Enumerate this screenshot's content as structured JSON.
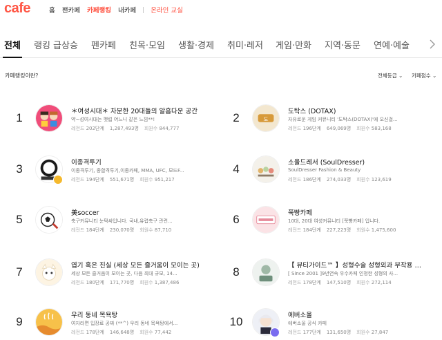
{
  "header": {
    "logo": "cafe",
    "nav": [
      "홈",
      "팬카페",
      "카페랭킹",
      "내카페"
    ],
    "active_nav": "카페랭킹",
    "extra_link": "온라인 교실"
  },
  "tabs": [
    "전체",
    "랭킹 급상승",
    "펜카페",
    "친목·모임",
    "생활·경제",
    "취미·레저",
    "게임·만화",
    "지역·동문",
    "연예·예술"
  ],
  "subbar": {
    "help": "카페랭킹이란?",
    "grade_filter": "전체등급 ⌄",
    "sort_filter": "카페점수 ⌄"
  },
  "colors": {
    "brand": "#ff5645",
    "badge_gold": "#f5b92d",
    "badge_purple": "#7a6cf0"
  },
  "rankings": [
    {
      "rank": "1",
      "name": "＊여성시대＊ 차분한 20대들의 알흠다운 공간",
      "desc": "약~성여시대는 펫럽 어느니 같은 느낌**!",
      "grade_label": "레전드",
      "grade_val": "202단계",
      "members": "1,287,493명",
      "visits_label": "회원수",
      "visits": "844,777",
      "icon": "yeosidae-thumb"
    },
    {
      "rank": "2",
      "name": "도탁스 (DOTAX)",
      "desc": "자유로운 게임 커뮤니티 '도탁스(DOTAX)'에 오신걸...",
      "grade_label": "레전드",
      "grade_val": "196단계",
      "members": "649,069명",
      "visits_label": "회원수",
      "visits": "583,168",
      "icon": "dotax-thumb"
    },
    {
      "rank": "3",
      "name": "이종격투기",
      "desc": "이종격투기, 종합격투기,이종카페, MMA, UFC, 모드F...",
      "grade_label": "레전드",
      "grade_val": "194단계",
      "members": "551,671명",
      "visits_label": "회원수",
      "visits": "951,217",
      "icon": "mma-thumb",
      "badge": "gold"
    },
    {
      "rank": "4",
      "name": "소울드레서 (SoulDresser)",
      "desc": "SoulDresser Fashion & Beauty",
      "grade_label": "레전드",
      "grade_val": "186단계",
      "members": "274,033명",
      "visits_label": "회원수",
      "visits": "123,619",
      "icon": "souldresser-thumb"
    },
    {
      "rank": "5",
      "name": "美soccer",
      "desc": "축구커뮤니티 눈팍싸입니다. 국내,유럽축구 관련...",
      "grade_label": "레전드",
      "grade_val": "184단계",
      "members": "230,070명",
      "visits_label": "회원수",
      "visits": "87,710",
      "icon": "soccer-thumb"
    },
    {
      "rank": "6",
      "name": "쭉빵카페",
      "desc": "10대, 20대 여성커뮤니티 [쭉빵카페] 입니다.",
      "grade_label": "레전드",
      "grade_val": "184단계",
      "members": "227,223명",
      "visits_label": "회원수",
      "visits": "1,475,600",
      "icon": "jjukbbang-thumb"
    },
    {
      "rank": "7",
      "name": "엽기 혹은 진실 (세상 모든 즐거움이 모이는 곳)",
      "desc": "세상 모든 즐거움이 모이는 곳, 다음 최대 규모, 14...",
      "grade_label": "레전드",
      "grade_val": "180단계",
      "members": "171,770명",
      "visits_label": "회원수",
      "visits": "1,387,486",
      "icon": "yeopgi-thumb"
    },
    {
      "rank": "8",
      "name": "【 뷰티가이드™ 】성형수술 성형외과 부작용 후기",
      "desc": "[ Since 2001 ]9년연속 우수카페 인정한 성형의 사...",
      "grade_label": "레전드",
      "grade_val": "178단계",
      "members": "147,510명",
      "visits_label": "회원수",
      "visits": "272,114",
      "icon": "beautyguide-thumb"
    },
    {
      "rank": "9",
      "name": "우리 동네 목욕탕",
      "desc": "여자라면 입장료 공짜 (**^) 우리 동네 목욕탕에서...",
      "grade_label": "레전드",
      "grade_val": "178단계",
      "members": "146,648명",
      "visits_label": "회원수",
      "visits": "77,442",
      "icon": "bathhouse-thumb"
    },
    {
      "rank": "10",
      "name": "에버소울",
      "desc": "에버소울 공식 카페",
      "grade_label": "레전드",
      "grade_val": "177단계",
      "members": "131,650명",
      "visits_label": "회원수",
      "visits": "27,847",
      "icon": "eversoul-thumb",
      "badge": "purple"
    }
  ]
}
